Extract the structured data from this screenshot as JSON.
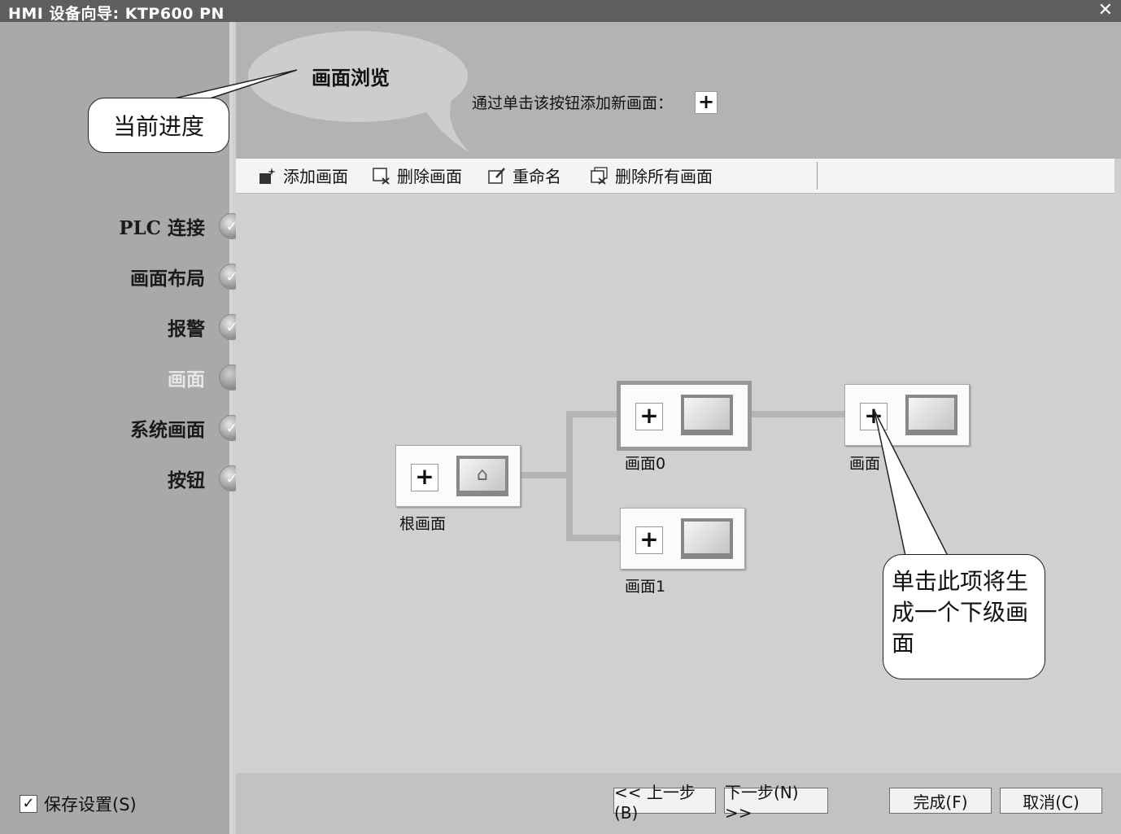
{
  "window": {
    "title": "HMI 设备向导: KTP600 PN",
    "close_icon": "✕"
  },
  "sidebar": {
    "steps": [
      {
        "label": "PLC 连接",
        "status": "done"
      },
      {
        "label": "画面布局",
        "status": "done"
      },
      {
        "label": "报警",
        "status": "done"
      },
      {
        "label": "画面",
        "status": "current"
      },
      {
        "label": "系统画面",
        "status": "done"
      },
      {
        "label": "按钮",
        "status": "done"
      }
    ],
    "save_settings": {
      "label": "保存设置(S)",
      "checked": true
    }
  },
  "header": {
    "title": "画面浏览",
    "hint": "通过单击该按钮添加新画面：",
    "hint_button": "+"
  },
  "toolbar": {
    "add": "添加画面",
    "delete": "删除画面",
    "rename": "重命名",
    "delete_all": "删除所有画面"
  },
  "tree": {
    "root": {
      "label": "根画面"
    },
    "screen0": {
      "label": "画面0",
      "selected": true
    },
    "screen1": {
      "label": "画面1"
    },
    "screen2": {
      "label": "画面"
    },
    "plus": "+",
    "home_icon": "⌂"
  },
  "callouts": {
    "progress": "当前进度",
    "subscreen": "单击此项将生成一个下级画面"
  },
  "footer": {
    "prev": "<< 上一步(B)",
    "next": "下一步(N) >>",
    "finish": "完成(F)",
    "cancel": "取消(C)"
  },
  "check_icon": "✓"
}
